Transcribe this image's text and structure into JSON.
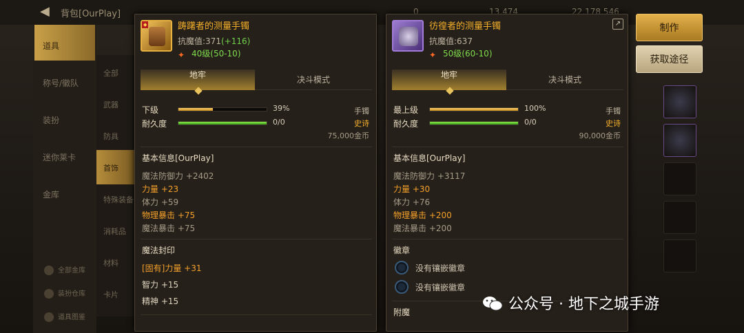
{
  "background": {
    "title": "背包[OurPlay]",
    "currency": [
      "0",
      "13,474",
      "22,178,546"
    ],
    "left_nav": [
      "道具",
      "称号/徽队",
      "装扮",
      "迷你莱卡",
      "金库"
    ],
    "sub_nav": [
      "全部",
      "武器",
      "防具",
      "首饰",
      "特殊装备",
      "消耗品",
      "材料",
      "卡片"
    ],
    "side_links": [
      "全部金库",
      "装扮仓库",
      "道具图鉴"
    ]
  },
  "left_item": {
    "name": "踌躇者的测量手镯",
    "resist_label": "抗魔值:371",
    "resist_bonus": "(+116)",
    "level": "40级(50-10)",
    "tabs": [
      "地牢",
      "决斗模式"
    ],
    "grade_label": "下级",
    "grade_pct": "39%",
    "grade_fraction": 0.39,
    "durability_label": "耐久度",
    "durability_value": "0/0",
    "durability_fraction": 1.0,
    "type": "手镯",
    "rarity": "史诗",
    "price": "75,000金币",
    "basic_title": "基本信息[OurPlay]",
    "stats": [
      {
        "text": "魔法防御力 +2402",
        "style": "gray"
      },
      {
        "text": "力量 +23",
        "style": "orange"
      },
      {
        "text": "体力 +59",
        "style": "gray"
      },
      {
        "text": "物理暴击 +75",
        "style": "orange"
      },
      {
        "text": "魔法暴击 +75",
        "style": "gray"
      }
    ],
    "seal_title": "魔法封印",
    "seal_lines": [
      {
        "text": "[固有]力量 +31",
        "style": "orange"
      },
      {
        "text": "智力 +15",
        "style": "white"
      },
      {
        "text": "精神 +15",
        "style": "white"
      }
    ]
  },
  "right_item": {
    "name": "彷徨者的测量手镯",
    "resist_label": "抗魔值:637",
    "level": "50级(60-10)",
    "tabs": [
      "地牢",
      "决斗模式"
    ],
    "grade_label": "最上级",
    "grade_pct": "100%",
    "grade_fraction": 1.0,
    "durability_label": "耐久度",
    "durability_value": "0/0",
    "durability_fraction": 1.0,
    "type": "手镯",
    "rarity": "史诗",
    "price": "90,000金币",
    "basic_title": "基本信息[OurPlay]",
    "stats": [
      {
        "text": "魔法防御力 +3117",
        "style": "gray"
      },
      {
        "text": "力量 +30",
        "style": "orange"
      },
      {
        "text": "体力 +76",
        "style": "gray"
      },
      {
        "text": "物理暴击 +200",
        "style": "orange"
      },
      {
        "text": "魔法暴击 +200",
        "style": "gray"
      }
    ],
    "emblem_title": "徽章",
    "emblem_slots": [
      "没有镶嵌徽章",
      "没有镶嵌徽章"
    ],
    "enchant_title": "附魔"
  },
  "buttons": {
    "make": "制作",
    "obtain": "获取途径"
  },
  "watermark": "公众号 · 地下之城手游",
  "colors": {
    "epic": "#f5b02a",
    "bonus": "#6fd04a",
    "level": "#7fdc4c",
    "accent_gold": "#e3b04a"
  }
}
